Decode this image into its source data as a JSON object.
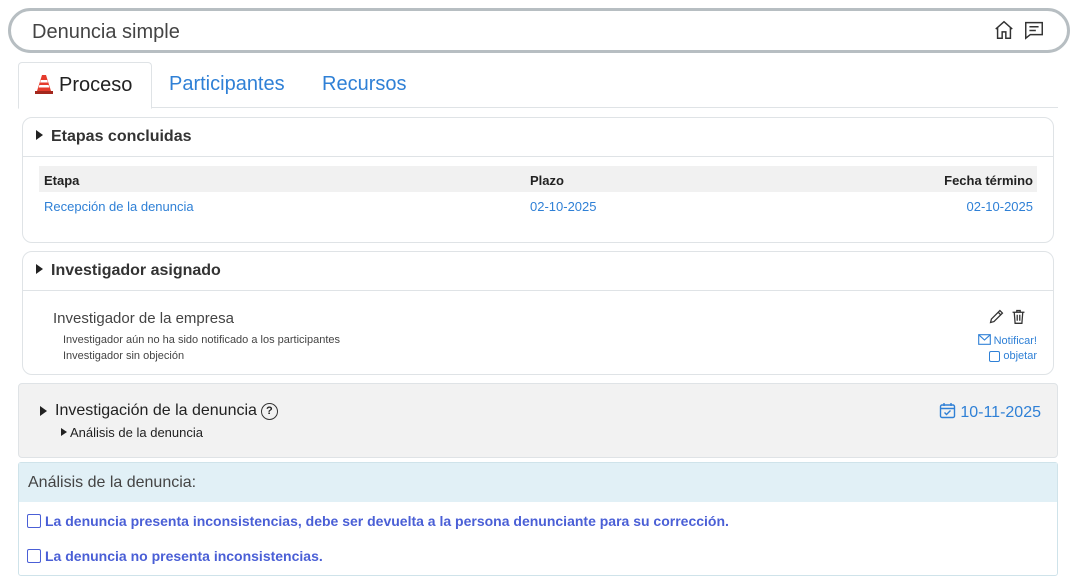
{
  "header": {
    "title": "Denuncia simple"
  },
  "tabs": [
    {
      "label": "Proceso",
      "active": true
    },
    {
      "label": "Participantes",
      "active": false
    },
    {
      "label": "Recursos",
      "active": false
    }
  ],
  "etapas": {
    "title": "Etapas concluidas",
    "columns": [
      "Etapa",
      "Plazo",
      "Fecha término"
    ],
    "rows": [
      {
        "etapa": "Recepción de la denuncia",
        "plazo": "02-10-2025",
        "fecha": "02-10-2025"
      }
    ]
  },
  "investigador": {
    "title": "Investigador asignado",
    "name": "Investigador de la empresa",
    "note1": "Investigador aún no ha sido notificado a los participantes",
    "note2": "Investigador sin objeción",
    "notify_label": "Notificar!",
    "object_label": "objetar"
  },
  "investigacion": {
    "title": "Investigación de la denuncia",
    "help_symbol": "?",
    "sub": "Análisis de la denuncia",
    "date": "10-11-2025"
  },
  "analisis": {
    "title": "Análisis de la denuncia:",
    "options": [
      "La denuncia presenta inconsistencias, debe ser devuelta a la persona denunciante para su corrección.",
      "La denuncia no presenta inconsistencias."
    ]
  },
  "colors": {
    "link": "#2f80d6",
    "option": "#4a5fd6",
    "panel_head": "#e1f0f6"
  }
}
